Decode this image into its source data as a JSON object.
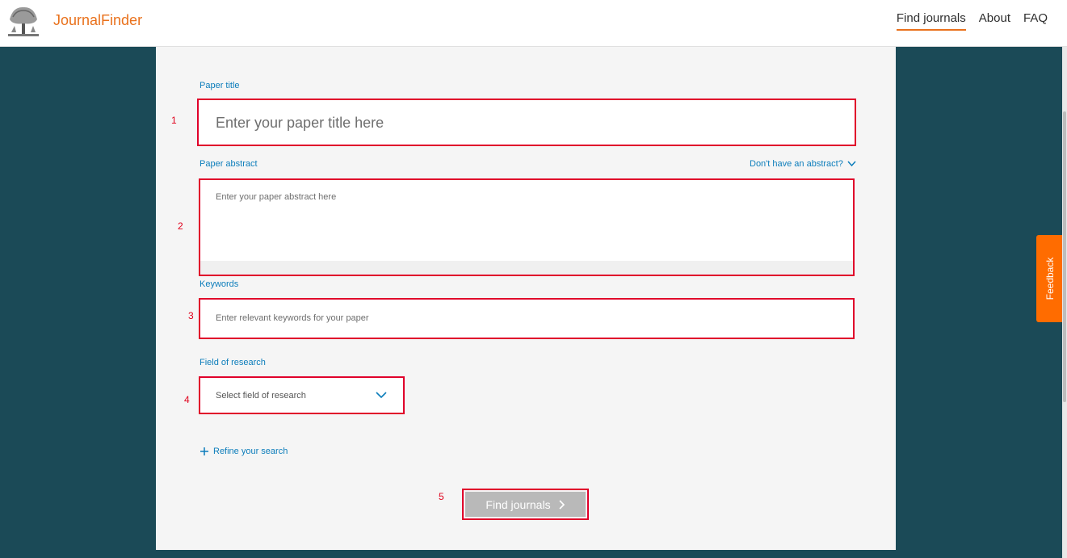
{
  "header": {
    "brand": "JournalFinder",
    "nav": [
      {
        "label": "Find journals",
        "active": true
      },
      {
        "label": "About",
        "active": false
      },
      {
        "label": "FAQ",
        "active": false
      }
    ],
    "logo_icon": "elsevier-tree-logo"
  },
  "form": {
    "title": {
      "label": "Paper title",
      "placeholder": "Enter your paper title here",
      "marker": "1"
    },
    "abstract": {
      "label": "Paper abstract",
      "placeholder": "Enter your paper abstract here",
      "marker": "2",
      "toggle": "Don't have an abstract?"
    },
    "keywords": {
      "label": "Keywords",
      "placeholder": "Enter relevant keywords for your paper",
      "marker": "3"
    },
    "field": {
      "label": "Field of research",
      "selected": "Select field of research",
      "marker": "4"
    },
    "refine": "Refine your search",
    "submit": {
      "label": "Find journals",
      "marker": "5"
    }
  },
  "feedback": "Feedback",
  "colors": {
    "accent": "#e9711c",
    "link": "#0c7dbb",
    "highlight": "#e0002a",
    "background": "#1b4a57",
    "feedback": "#ff6c00"
  }
}
